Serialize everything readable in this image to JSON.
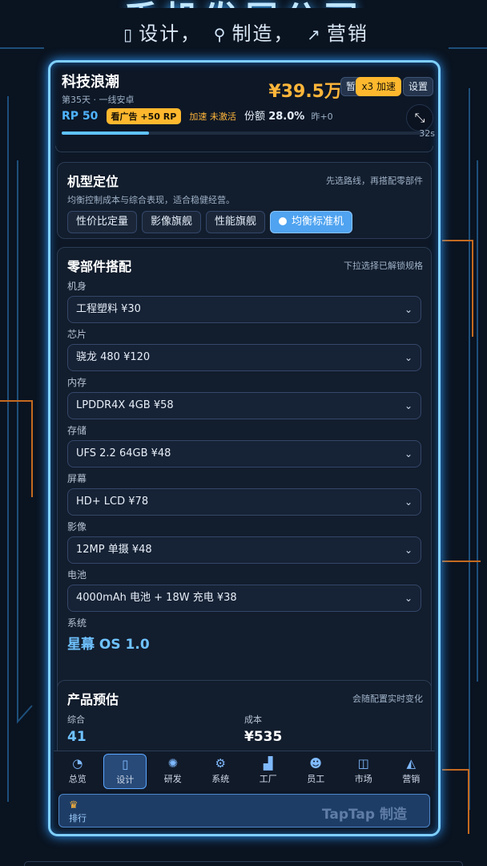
{
  "banner": {
    "title": "手机发展公司",
    "subtitle_parts": [
      "设计，",
      "制造，",
      "营销"
    ],
    "subtitle_icons": [
      "phone-icon",
      "wrench-icon",
      "chart-icon"
    ]
  },
  "header": {
    "company": "科技浪潮",
    "day_line": "第35天 · 一线安卓",
    "money": "¥39.5万",
    "pause_label": "暂停",
    "speed_label": "x3 加速",
    "settings_label": "设置",
    "rp": "RP 50",
    "ad_label": "看广告 +50 RP",
    "boost_label": "加速 未激活",
    "share_label": "份额",
    "share_value": "28.0%",
    "yesterday": "昨+0",
    "timer": "32s",
    "progress": 0.24
  },
  "positioning": {
    "title": "机型定位",
    "hint": "先选路线，再搭配零部件",
    "desc": "均衡控制成本与综合表现，适合稳健经营。",
    "options": [
      "性价比定量",
      "影像旗舰",
      "性能旗舰",
      "均衡标准机"
    ],
    "selected": "均衡标准机"
  },
  "parts": {
    "title": "零部件搭配",
    "hint": "下拉选择已解锁规格",
    "items": [
      {
        "label": "机身",
        "value": "工程塑料 ¥30"
      },
      {
        "label": "芯片",
        "value": "骁龙 480 ¥120"
      },
      {
        "label": "内存",
        "value": "LPDDR4X 4GB ¥58"
      },
      {
        "label": "存储",
        "value": "UFS 2.2 64GB ¥48"
      },
      {
        "label": "屏幕",
        "value": "HD+ LCD ¥78"
      },
      {
        "label": "影像",
        "value": "12MP 单摄 ¥48"
      },
      {
        "label": "电池",
        "value": "4000mAh 电池 + 18W 充电 ¥38"
      }
    ],
    "os_label": "系统",
    "os_value": "星幕 OS 1.0"
  },
  "estimate": {
    "title": "产品预估",
    "hint": "会随配置实时变化",
    "overall_label": "综合",
    "overall_value": "41",
    "cost_label": "成本",
    "cost_value": "¥535"
  },
  "nav": {
    "items": [
      {
        "label": "总览",
        "icon": "gauge-icon"
      },
      {
        "label": "设计",
        "icon": "phone-icon"
      },
      {
        "label": "研发",
        "icon": "gear-icon"
      },
      {
        "label": "系统",
        "icon": "cog-icon"
      },
      {
        "label": "工厂",
        "icon": "factory-icon"
      },
      {
        "label": "员工",
        "icon": "people-icon"
      },
      {
        "label": "市场",
        "icon": "market-icon"
      },
      {
        "label": "营销",
        "icon": "megaphone-icon"
      }
    ],
    "active": "设计",
    "rank_label": "排行",
    "watermark": "TapTap 制造"
  },
  "colors": {
    "accent": "#4fa3f0",
    "gold": "#ffb63a",
    "frame": "#7fd0ff"
  }
}
